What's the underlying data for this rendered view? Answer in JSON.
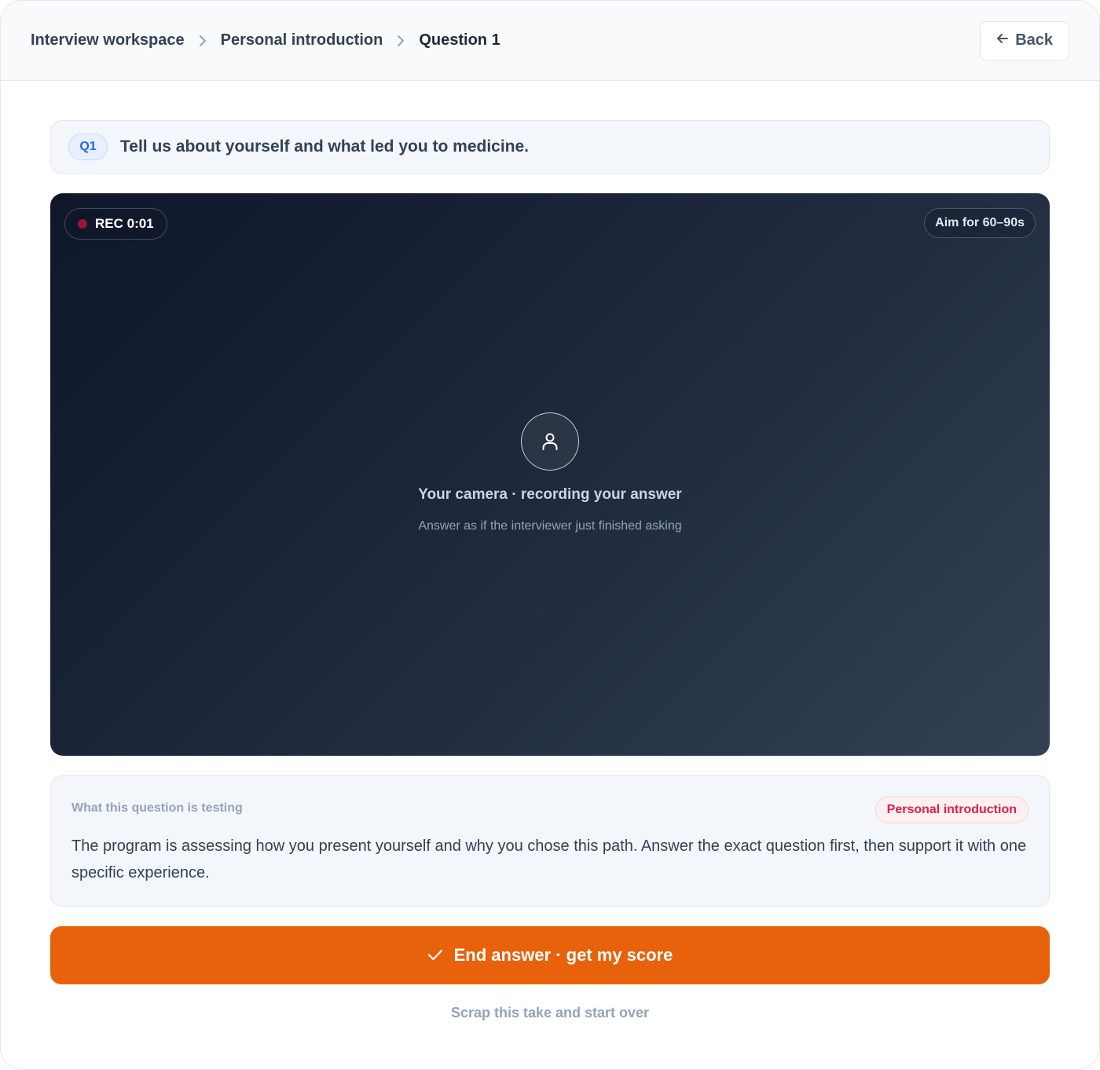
{
  "breadcrumb": {
    "items": [
      "Interview workspace",
      "Personal introduction",
      "Question 1"
    ]
  },
  "header": {
    "back_label": "Back"
  },
  "question": {
    "badge": "Q1",
    "text": "Tell us about yourself and what led you to medicine."
  },
  "video": {
    "rec_label": "REC 0:01",
    "aim_label": "Aim for 60–90s",
    "camera_title": "Your camera · recording your answer",
    "camera_subtitle": "Answer as if the interviewer just finished asking"
  },
  "testing": {
    "label": "What this question is testing",
    "category": "Personal introduction",
    "body": "The program is assessing how you present yourself and why you chose this path. Answer the exact question first, then support it with one specific experience."
  },
  "actions": {
    "end_label": "End answer · get my score",
    "scrap_label": "Scrap this take and start over"
  },
  "colors": {
    "accent": "#e8620c",
    "rec_dot": "#9f1239",
    "badge_blue": "#2563eb",
    "category_red": "#e11d48"
  },
  "icons": [
    "chevron-right-icon",
    "arrow-left-icon",
    "user-icon",
    "checkmark-icon"
  ]
}
